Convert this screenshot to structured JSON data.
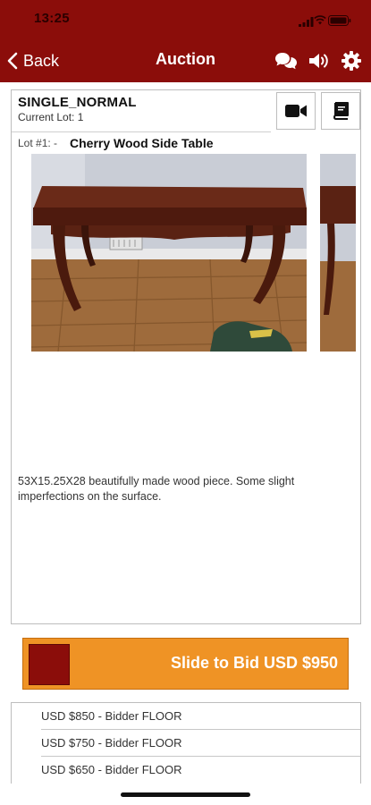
{
  "status_bar": {
    "time": "13:25"
  },
  "nav": {
    "back_label": "Back",
    "title": "Auction",
    "icons": [
      "chat-bubbles-icon",
      "speaker-icon",
      "gear-icon"
    ]
  },
  "lot_panel": {
    "sale_type": "SINGLE_NORMAL",
    "current_lot": "Current Lot: 1",
    "lot_number": "Lot #1: -",
    "lot_title": "Cherry Wood Side Table",
    "description": "53X15.25X28 beautifully made wood piece. Some slight imperfections on the surface.",
    "buttons": [
      "video-camera-icon",
      "catalog-book-icon"
    ]
  },
  "bid_slider": {
    "label": "Slide to Bid USD $950",
    "track_color": "#ef9325",
    "thumb_color": "#8b0d0a"
  },
  "bids": [
    {
      "text": "USD $850 - Bidder FLOOR"
    },
    {
      "text": "USD $750 - Bidder FLOOR"
    },
    {
      "text": "USD $650 - Bidder FLOOR"
    }
  ],
  "colors": {
    "brand": "#8b0d0a",
    "accent": "#ef9325"
  }
}
